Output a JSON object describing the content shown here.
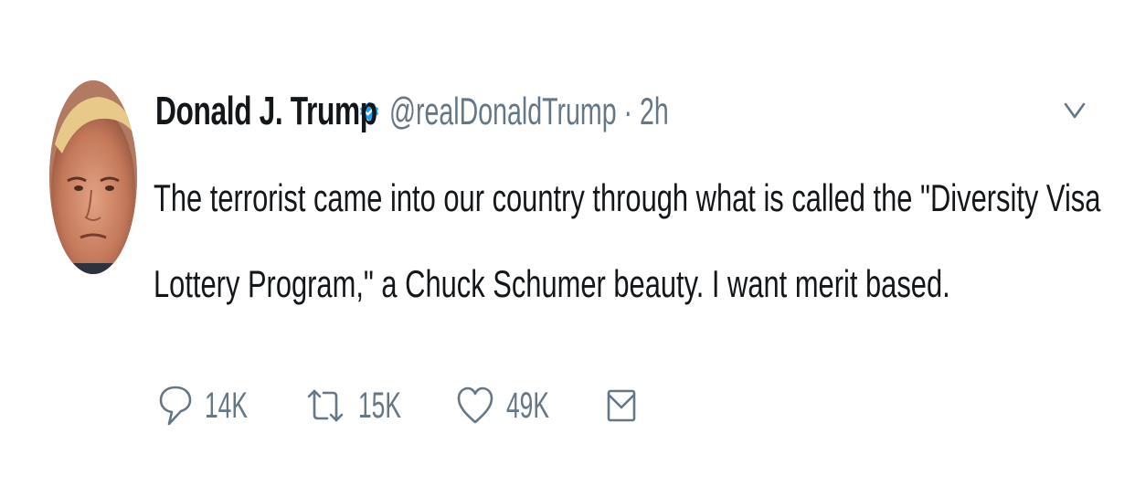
{
  "tweet": {
    "author_name": "Donald J. Trump",
    "handle": "@realDonaldTrump",
    "separator": "·",
    "time": "2h",
    "text_lines": [
      "The terrorist came into our country through what is called the \"Diversity Visa",
      "Lottery Program,\" a Chuck Schumer beauty. I want merit based."
    ],
    "verified_icon": "verified-badge-icon",
    "menu_icon": "chevron-down-icon",
    "colors": {
      "text": "#14171a",
      "secondary": "#657786",
      "verified": "#1da1f2"
    }
  },
  "actions": {
    "reply": {
      "icon": "reply-icon",
      "count": "14K"
    },
    "retweet": {
      "icon": "retweet-icon",
      "count": "15K"
    },
    "like": {
      "icon": "heart-icon",
      "count": "49K"
    },
    "message": {
      "icon": "envelope-icon"
    }
  }
}
